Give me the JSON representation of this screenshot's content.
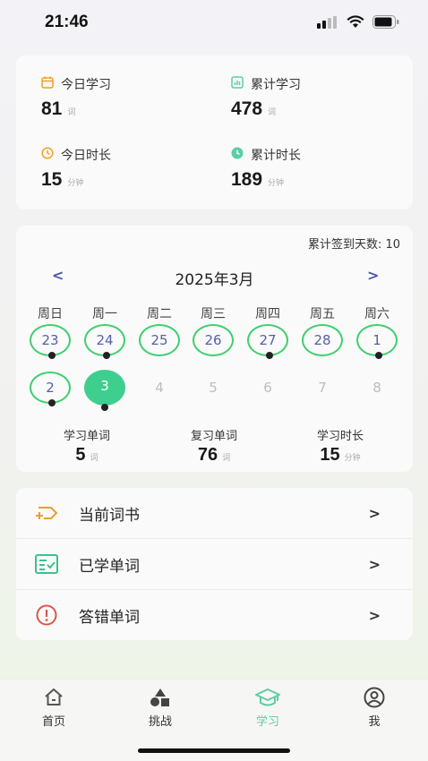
{
  "status_bar": {
    "time": "21:46"
  },
  "stats": {
    "today_learn": {
      "label": "今日学习",
      "value": "81",
      "unit": "词",
      "icon": "calendar-icon"
    },
    "total_learn": {
      "label": "累计学习",
      "value": "478",
      "unit": "词",
      "icon": "bar-chart-icon"
    },
    "today_time": {
      "label": "今日时长",
      "value": "15",
      "unit": "分钟",
      "icon": "clock-icon"
    },
    "total_time": {
      "label": "累计时长",
      "value": "189",
      "unit": "分钟",
      "icon": "clock-filled-icon"
    }
  },
  "calendar": {
    "checkin_text": "累计签到天数: 10",
    "month": "2025年3月",
    "prev": "<",
    "next": ">",
    "weekdays": [
      "周日",
      "周一",
      "周二",
      "周三",
      "周四",
      "周五",
      "周六"
    ],
    "week1": [
      "23",
      "24",
      "25",
      "26",
      "27",
      "28",
      "1"
    ],
    "week2": [
      "2",
      "3",
      "4",
      "5",
      "6",
      "7",
      "8"
    ]
  },
  "summary": {
    "learn_words": {
      "label": "学习单词",
      "value": "5",
      "unit": "词"
    },
    "review_words": {
      "label": "复习单词",
      "value": "76",
      "unit": "词"
    },
    "study_time": {
      "label": "学习时长",
      "value": "15",
      "unit": "分钟"
    }
  },
  "menu": {
    "items": [
      {
        "label": "当前词书",
        "icon": "book-tag-icon",
        "chevron": ">"
      },
      {
        "label": "已学单词",
        "icon": "checklist-icon",
        "chevron": ">"
      },
      {
        "label": "答错单词",
        "icon": "alert-icon",
        "chevron": ">"
      }
    ]
  },
  "tabbar": {
    "tabs": [
      {
        "label": "首页",
        "icon": "home-icon"
      },
      {
        "label": "挑战",
        "icon": "shapes-icon"
      },
      {
        "label": "学习",
        "icon": "graduation-cap-icon"
      },
      {
        "label": "我",
        "icon": "profile-icon"
      }
    ],
    "active_color": "#5ccda6"
  },
  "colors": {
    "ring": "#3fcf6f",
    "today": "#3ecf8e",
    "accent_blue": "#4a56a8"
  }
}
